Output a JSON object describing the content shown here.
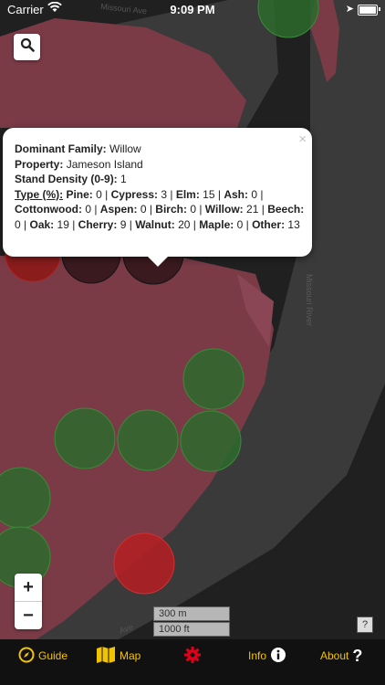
{
  "status_bar": {
    "carrier": "Carrier",
    "time": "9:09 PM"
  },
  "map": {
    "scale_metric": "300 m",
    "scale_imperial": "1000 ft",
    "street_label_top": "Missouri Ave",
    "river_label": "Missouri River",
    "street_label_bottom": "Ave"
  },
  "popup": {
    "dominant_family_label": "Dominant Family:",
    "dominant_family_value": "Willow",
    "property_label": "Property:",
    "property_value": "Jameson Island",
    "density_label": "Stand Density (0-9):",
    "density_value": "1",
    "type_label": "Type (%):",
    "types": [
      {
        "name": "Pine:",
        "value": "0"
      },
      {
        "name": "Cypress:",
        "value": "3"
      },
      {
        "name": "Elm:",
        "value": "15"
      },
      {
        "name": "Ash:",
        "value": "0"
      },
      {
        "name": "Cottonwood:",
        "value": "0"
      },
      {
        "name": "Aspen:",
        "value": "0"
      },
      {
        "name": "Birch:",
        "value": "0"
      },
      {
        "name": "Willow:",
        "value": "21"
      },
      {
        "name": "Beech:",
        "value": "0"
      },
      {
        "name": "Oak:",
        "value": "19"
      },
      {
        "name": "Cherry:",
        "value": "9"
      },
      {
        "name": "Walnut:",
        "value": "20"
      },
      {
        "name": "Maple:",
        "value": "0"
      },
      {
        "name": "Other:",
        "value": "13"
      }
    ],
    "close": "×"
  },
  "controls": {
    "zoom_in": "+",
    "zoom_out": "−",
    "help": "?"
  },
  "tabs": [
    {
      "label": "Guide"
    },
    {
      "label": "Map"
    },
    {
      "label": ""
    },
    {
      "label": "Info"
    },
    {
      "label": "About"
    }
  ],
  "colors": {
    "tab_accent": "#f2c400",
    "gear_red": "#e0001a",
    "land_pink": "#7a3b47",
    "river_gray": "#3a3a3a"
  }
}
